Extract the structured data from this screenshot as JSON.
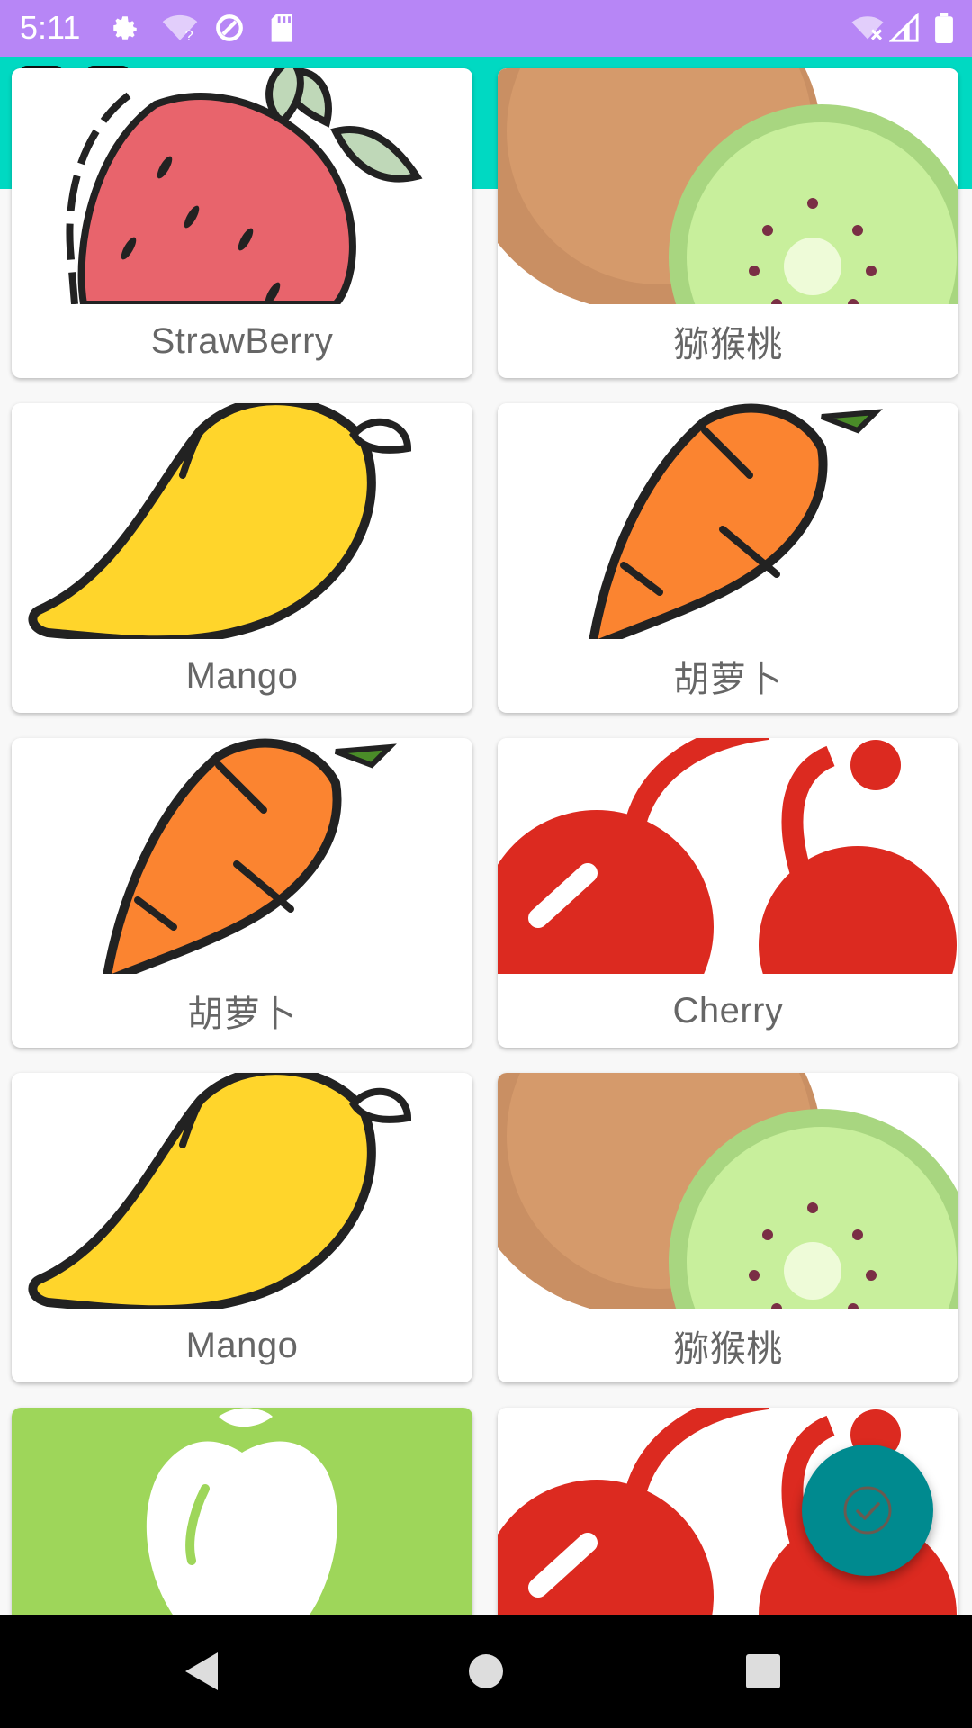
{
  "status_bar": {
    "time": "5:11",
    "icons": [
      "settings-icon",
      "wifi-question-icon",
      "sync-icon",
      "sd-card-icon",
      "wifi-off-icon",
      "signal-icon",
      "battery-icon"
    ]
  },
  "grid": {
    "items": [
      {
        "label": "StrawBerry",
        "icon": "strawberry"
      },
      {
        "label": "猕猴桃",
        "icon": "kiwi"
      },
      {
        "label": "Mango",
        "icon": "mango"
      },
      {
        "label": "胡萝卜",
        "icon": "carrot"
      },
      {
        "label": "胡萝卜",
        "icon": "carrot"
      },
      {
        "label": "Cherry",
        "icon": "cherry"
      },
      {
        "label": "Mango",
        "icon": "mango"
      },
      {
        "label": "猕猴桃",
        "icon": "kiwi"
      },
      {
        "label": "",
        "icon": "apple"
      },
      {
        "label": "",
        "icon": "cherry"
      }
    ]
  },
  "fab": {
    "icon": "check-circle-icon"
  },
  "nav_bar": {
    "buttons": [
      "back",
      "home",
      "recents"
    ]
  },
  "colors": {
    "status_bar": "#b786f6",
    "toolbar": "#00d9c2",
    "fab": "#008a8f"
  }
}
